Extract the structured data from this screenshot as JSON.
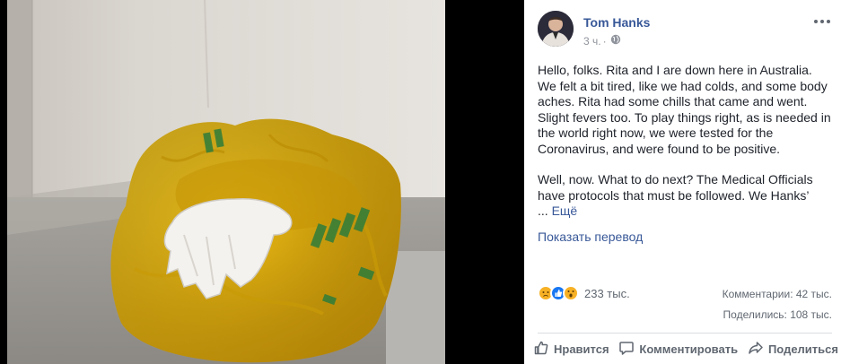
{
  "post": {
    "author": "Tom Hanks",
    "time": "3 ч.",
    "privacy_icon": "globe-icon",
    "paragraphs": [
      "Hello, folks. Rita and I are down here in Australia. We felt a bit tired, like we had colds, and some body aches. Rita had some chills that came and went. Slight fevers too. To play things right, as is needed in the world right now, we were tested for the Coronavirus, and were found to be positive.",
      "Well, now. What to do next? The Medical Officials have protocols that must be followed. We Hanks’"
    ],
    "ellipsis": "...",
    "see_more": "Ещё",
    "translate": "Показать перевод"
  },
  "stats": {
    "reaction_icons": [
      "sad-reaction-icon",
      "like-reaction-icon",
      "wow-reaction-icon"
    ],
    "reactions_count": "233 тыс.",
    "comments": "Комментарии: 42 тыс.",
    "shares": "Поделились: 108 тыс."
  },
  "actions": {
    "like": "Нравится",
    "comment": "Комментировать",
    "share": "Поделиться"
  },
  "colors": {
    "link": "#385898",
    "text": "#1d2129",
    "muted": "#606770",
    "bag_yellow": "#f2c21a"
  }
}
